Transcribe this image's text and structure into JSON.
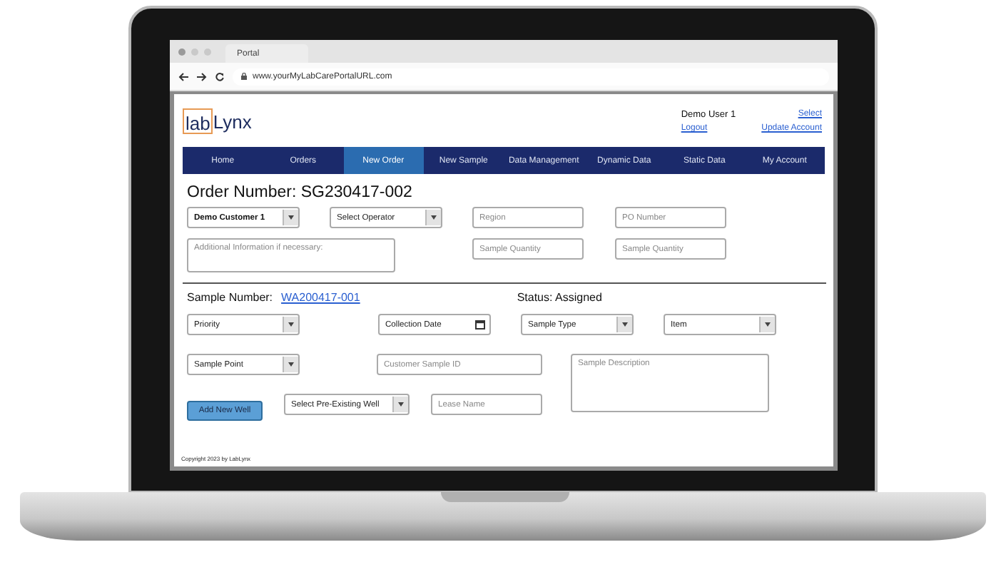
{
  "browser": {
    "tab_title": "Portal",
    "url": "www.yourMyLabCarePortalURL.com"
  },
  "header": {
    "logo": {
      "boxed": "lab",
      "rest": "Lynx"
    },
    "user": "Demo User 1",
    "links": [
      {
        "label": "Select"
      },
      {
        "label": "Logout"
      },
      {
        "label": "Update Account"
      }
    ]
  },
  "nav": [
    {
      "label": "Home",
      "selected": false
    },
    {
      "label": "Orders",
      "selected": false
    },
    {
      "label": "New Order",
      "selected": true
    },
    {
      "label": "New Sample",
      "selected": false
    },
    {
      "label": "Data Management",
      "selected": false
    },
    {
      "label": "Dynamic Data",
      "selected": false
    },
    {
      "label": "Static Data",
      "selected": false
    },
    {
      "label": "My Account",
      "selected": false
    }
  ],
  "order": {
    "title": "Order Number: SG230417-002",
    "rows": [
      [
        {
          "kind": "select",
          "value": "Demo Customer 1"
        },
        {
          "kind": "select",
          "placeholder": "Select Operator"
        },
        {
          "kind": "input",
          "placeholder": "Region"
        },
        {
          "kind": "input",
          "placeholder": "PO Number"
        }
      ],
      [
        {
          "kind": "textarea",
          "placeholder": "Additional Information if necessary:"
        },
        "",
        {
          "kind": "input",
          "placeholder": "Sample Quantity"
        },
        {
          "kind": "input",
          "placeholder": "Sample Quantity"
        }
      ]
    ]
  },
  "sample": {
    "label": "Sample Number:",
    "number": "WA200417-001",
    "status": "Status: Assigned",
    "rows": [
      [
        {
          "kind": "select",
          "placeholder": "Priority"
        },
        {
          "kind": "date",
          "placeholder": "Collection Date"
        },
        {
          "kind": "select",
          "placeholder": "Sample Type"
        },
        {
          "kind": "select",
          "placeholder": "Item"
        }
      ],
      [
        {
          "kind": "select",
          "placeholder": "Sample Point"
        },
        {
          "kind": "input",
          "placeholder": "Customer Sample ID"
        }
      ],
      [
        {
          "kind": "button",
          "label": "Add New Well"
        },
        {
          "kind": "select",
          "placeholder": "Select Pre-Existing Well"
        },
        {
          "kind": "input",
          "placeholder": "Lease Name"
        }
      ]
    ],
    "description": {
      "kind": "textarea",
      "placeholder": "Sample Description"
    }
  },
  "footer": {
    "copyright": "Copyright 2023 by LabLynx"
  }
}
